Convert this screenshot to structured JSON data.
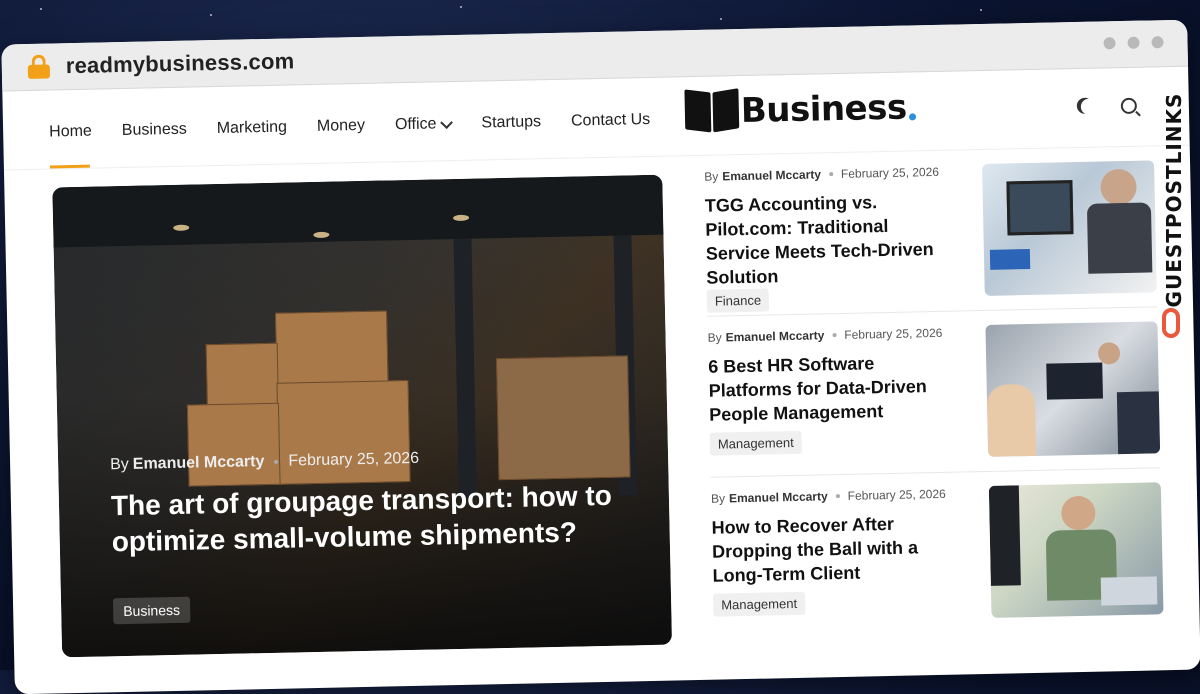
{
  "browser": {
    "url": "readmybusiness.com"
  },
  "nav": {
    "items": [
      {
        "label": "Home"
      },
      {
        "label": "Business"
      },
      {
        "label": "Marketing"
      },
      {
        "label": "Money"
      },
      {
        "label": "Office"
      },
      {
        "label": "Startups"
      },
      {
        "label": "Contact Us"
      }
    ],
    "active": "Home",
    "logo_text": "Business",
    "accent_color": "#f3a019",
    "logo_dot_color": "#2a8fe0"
  },
  "hero": {
    "author_prefix": "By",
    "author": "Emanuel Mccarty",
    "date": "February 25, 2026",
    "title": "The art of groupage transport: how to optimize small-volume shipments?",
    "tag": "Business"
  },
  "articles": [
    {
      "author_prefix": "By",
      "author": "Emanuel Mccarty",
      "date": "February 25, 2026",
      "title": "TGG Accounting vs. Pilot.com: Traditional Service Meets Tech-Driven Solution",
      "tag": "Finance"
    },
    {
      "author_prefix": "By",
      "author": "Emanuel Mccarty",
      "date": "February 25, 2026",
      "title": "6 Best HR Software Platforms for Data-Driven People Management",
      "tag": "Management"
    },
    {
      "author_prefix": "By",
      "author": "Emanuel Mccarty",
      "date": "February 25, 2026",
      "title": "How to Recover After Dropping the Ball with a Long-Term Client",
      "tag": "Management"
    }
  ],
  "badge": {
    "text": "GUESTPOSTLINKS"
  }
}
